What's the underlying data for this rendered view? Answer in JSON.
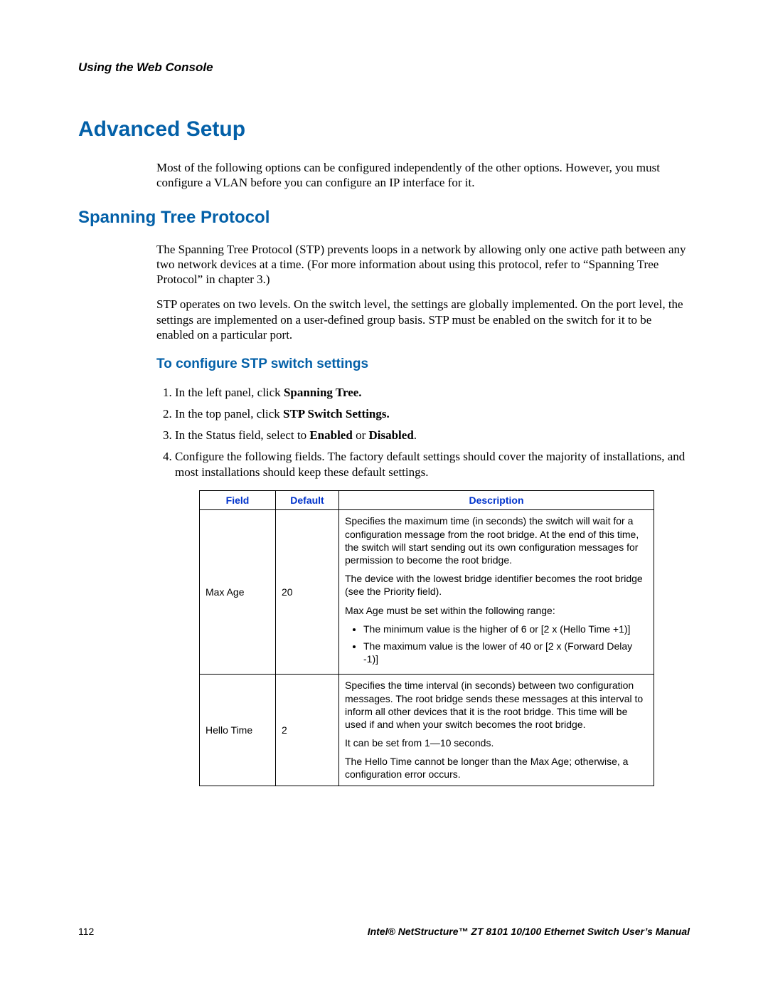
{
  "chapter_header": "Using the Web Console",
  "h1": "Advanced Setup",
  "intro_p1": "Most of the following options can be configured independently of the other options. However, you must configure a VLAN before you can configure an IP interface for it.",
  "h2": "Spanning Tree Protocol",
  "stp_p1": "The Spanning Tree Protocol (STP) prevents loops in a network by allowing only one active path between any two network devices at a time. (For more information about using this protocol, refer to “Spanning Tree Protocol” in chapter 3.)",
  "stp_p2": "STP operates on two levels. On the switch level, the settings are globally implemented. On the port level, the settings are implemented on a user-defined group basis. STP must be enabled on the switch for it to be enabled on a particular port.",
  "h3": "To configure STP switch settings",
  "steps": {
    "s1_pre": "In the left panel, click ",
    "s1_bold": "Spanning Tree.",
    "s2_pre": "In the top panel, click ",
    "s2_bold": "STP Switch Settings.",
    "s3_pre": "In the Status field, select to ",
    "s3_b1": "Enabled",
    "s3_mid": " or ",
    "s3_b2": "Disabled",
    "s3_post": ".",
    "s4": "Configure the following fields. The factory default settings should cover the majority of installations, and most installations should keep these default settings."
  },
  "table": {
    "head": {
      "field": "Field",
      "default": "Default",
      "description": "Description"
    },
    "row1": {
      "field": "Max Age",
      "default": "20",
      "d1": "Specifies the maximum time (in seconds) the switch will wait for a configuration message from the root bridge. At the end of this time, the switch will start sending out its own configuration messages for permission to become the root bridge.",
      "d2": "The device with the lowest bridge identifier becomes the root bridge (see the Priority field).",
      "d3": "Max Age must be set within the following range:",
      "b1": "The minimum value is the higher of 6 or [2 x (Hello Time +1)]",
      "b2": "The maximum value is the lower of 40 or [2 x (Forward Delay -1)]"
    },
    "row2": {
      "field": "Hello Time",
      "default": "2",
      "d1": "Specifies the time interval (in seconds) between two configuration messages. The root bridge sends these messages at this interval to inform all other devices that it is the root bridge. This time will be used if and when your switch becomes the root bridge.",
      "d2": "It can be set from 1—10 seconds.",
      "d3": "The Hello Time cannot be longer than the Max Age; otherwise, a configuration error occurs."
    }
  },
  "footer": {
    "page_number": "112",
    "manual_title": "Intel® NetStructure™  ZT 8101 10/100 Ethernet Switch User’s Manual"
  }
}
